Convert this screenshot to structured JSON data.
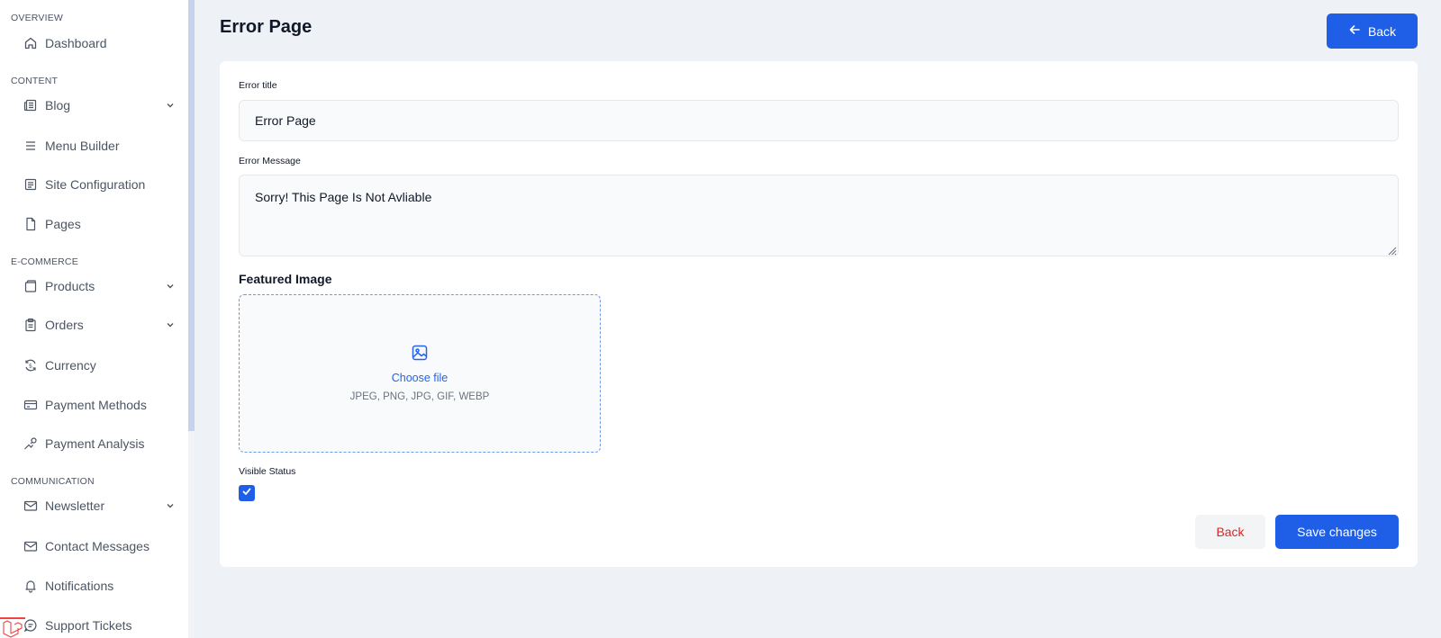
{
  "sidebar": {
    "sections": {
      "overview": "OVERVIEW",
      "content": "CONTENT",
      "ecommerce": "E-COMMERCE",
      "communication": "COMMUNICATION"
    },
    "items": {
      "dashboard": "Dashboard",
      "blog": "Blog",
      "menu_builder": "Menu Builder",
      "site_configuration": "Site Configuration",
      "pages": "Pages",
      "products": "Products",
      "orders": "Orders",
      "currency": "Currency",
      "payment_methods": "Payment Methods",
      "payment_analysis": "Payment Analysis",
      "newsletter": "Newsletter",
      "contact_messages": "Contact Messages",
      "notifications": "Notifications",
      "support_tickets": "Support Tickets"
    }
  },
  "header": {
    "title": "Error Page",
    "back_label": "Back"
  },
  "form": {
    "error_title_label": "Error title",
    "error_title_value": "Error Page",
    "error_message_label": "Error Message",
    "error_message_value": "Sorry! This Page Is Not Avliable",
    "featured_image_label": "Featured Image",
    "choose_file_label": "Choose file",
    "file_types": "JPEG, PNG, JPG, GIF, WEBP",
    "visible_status_label": "Visible Status",
    "visible_status_checked": true,
    "back_label": "Back",
    "save_label": "Save changes"
  },
  "colors": {
    "primary": "#1f5fe8",
    "danger": "#dc2626",
    "background": "#eef1f5"
  }
}
